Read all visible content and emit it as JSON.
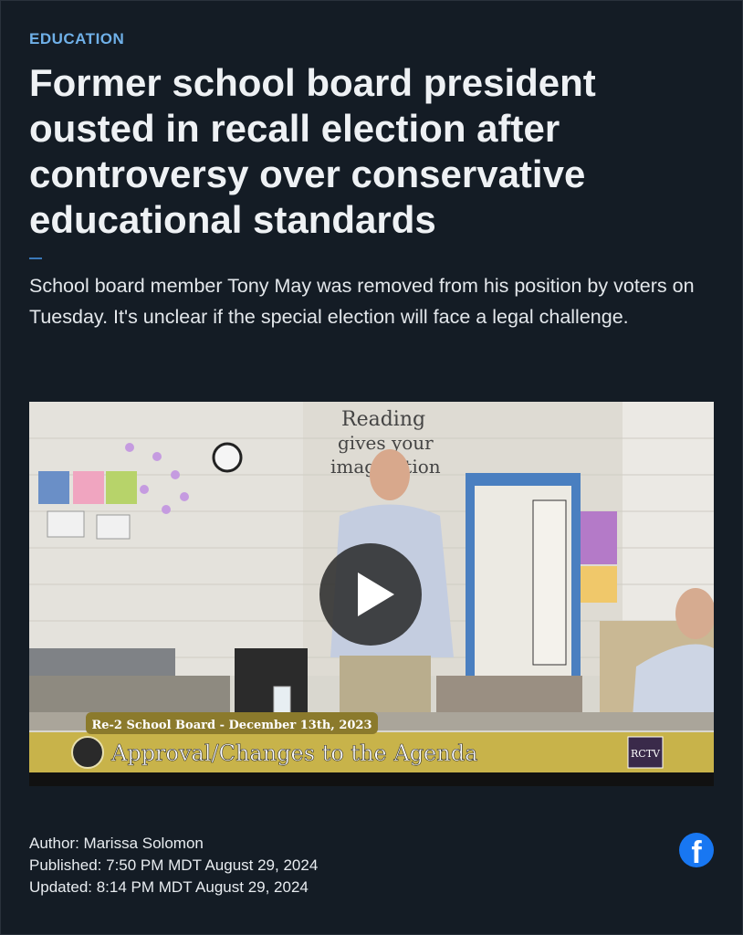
{
  "article": {
    "category": "EDUCATION",
    "headline": "Former school board president ousted in recall election after controversy over conservative educational standards",
    "dek": "School board member Tony May was removed from his position by voters on Tuesday. It's unclear if the special election will face a legal challenge."
  },
  "video": {
    "banner_top": "Re-2 School Board - December 13th, 2023",
    "banner_main": "Approval/Changes to the Agenda",
    "logo_text": "RCTV",
    "wall_text_line1": "Reading",
    "wall_text_line2": "gives your",
    "wall_text_line3": "imagination",
    "play_icon": "play-icon"
  },
  "meta": {
    "author": "Author: Marissa Solomon",
    "published": "Published: 7:50 PM MDT August 29, 2024",
    "updated": "Updated: 8:14 PM MDT August 29, 2024"
  },
  "share": {
    "facebook_icon": "facebook-icon",
    "facebook_color": "#1877f2"
  },
  "colors": {
    "background": "#141c25",
    "category": "#6fb0e8",
    "banner": "#c8b34a"
  }
}
